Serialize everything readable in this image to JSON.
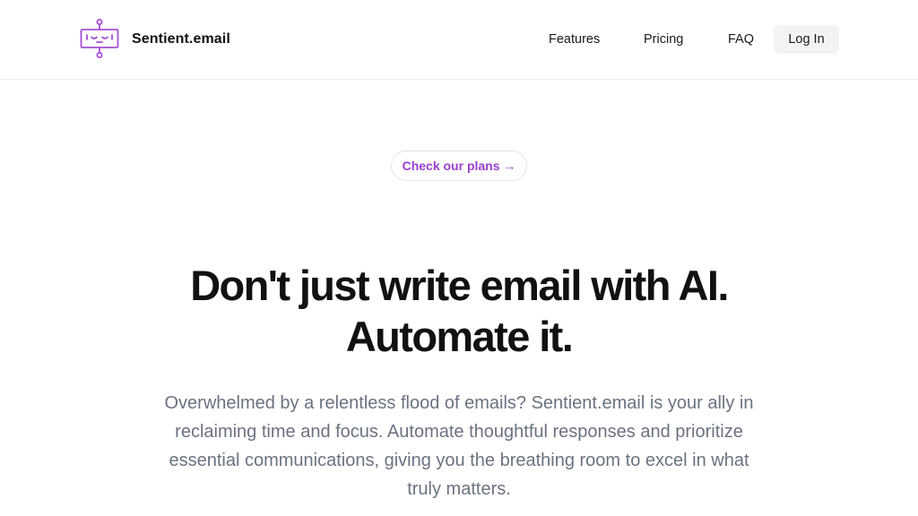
{
  "header": {
    "brand": "Sentient.email",
    "nav": [
      "Features",
      "Pricing",
      "FAQ"
    ],
    "login_label": "Log In"
  },
  "hero": {
    "pill_label": "Check our plans →",
    "title_line1": "Don't just write email with AI.",
    "title_line2": "Automate it.",
    "description": "Overwhelmed by a relentless flood of emails? Sentient.email is your ally in reclaiming time and focus. Automate thoughtful responses and prioritize essential communications, giving you the breathing room to excel in what truly matters."
  },
  "colors": {
    "accent": "#9b3fd0",
    "text": "#111111",
    "muted": "#6b7280",
    "button_bg": "#f1f3f5"
  },
  "icons": {
    "logo": "robot-face-logo-icon"
  }
}
